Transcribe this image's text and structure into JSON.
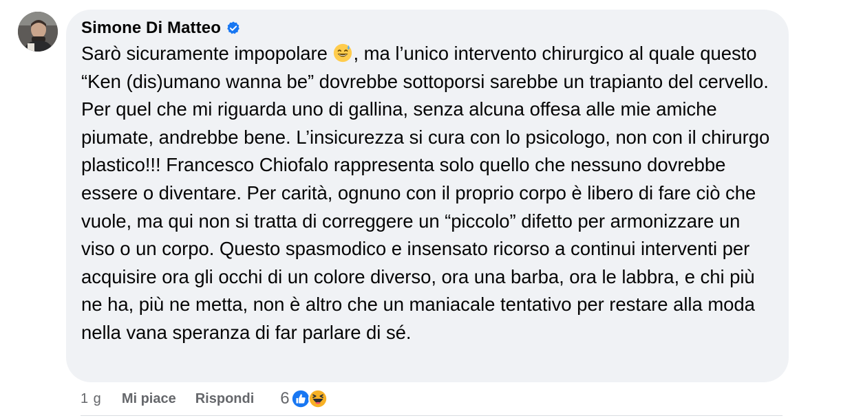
{
  "comment": {
    "author": "Simone Di Matteo",
    "verified_icon": "verified-badge-icon",
    "avatar_icon": "user-avatar",
    "text_before_emoji": "Sarò sicuramente impopolare ",
    "inline_emoji": "sweat-smile-emoji",
    "text_after_emoji": ", ma l’unico intervento chirurgico al quale questo “Ken (dis)umano wanna be” dovrebbe sottoporsi sarebbe un trapianto del cervello. Per quel che mi riguarda uno di gallina, senza alcuna offesa alle mie amiche piumate, andrebbe bene. L’insicurezza si cura con lo psicologo, non con il chirurgo plastico!!! Francesco Chiofalo rappresenta solo quello che nessuno dovrebbe essere o diventare. Per carità, ognuno con il proprio corpo è libero di fare ciò che vuole, ma qui non si tratta di correggere un “piccolo” difetto per armonizzare un viso o un corpo. Questo spasmodico e insensato ricorso a continui interventi per acquisire ora gli occhi di un colore diverso, ora una barba, ora le labbra, e chi più ne ha, più ne metta, non è altro che un maniacale tentativo per restare alla moda nella vana speranza di far parlare di sé."
  },
  "actions": {
    "time": "1 g",
    "like_label": "Mi piace",
    "reply_label": "Rispondi"
  },
  "reactions": {
    "count": "6",
    "icons": [
      "like-reaction-icon",
      "haha-reaction-icon"
    ],
    "colors": {
      "like": "#1877f2",
      "haha": "#f7b125"
    }
  },
  "colors": {
    "bubble": "#f0f2f5",
    "text": "#050505",
    "secondary": "#65676b",
    "verified": "#1877f2"
  }
}
